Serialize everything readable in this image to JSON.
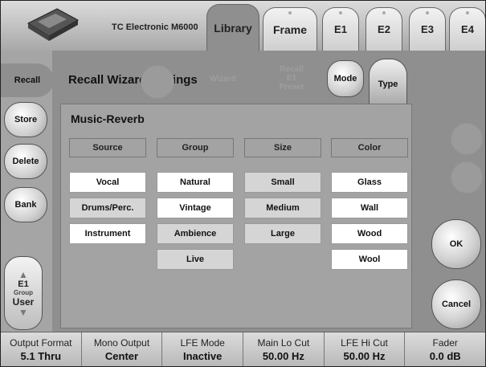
{
  "brand": "TC Electronic M6000",
  "tabs": [
    "Library",
    "Frame",
    "E1",
    "E2",
    "E3",
    "E4"
  ],
  "active_tab": "Library",
  "left_buttons": [
    "Recall",
    "Store",
    "Delete",
    "Bank"
  ],
  "group_button": {
    "line1": "E1",
    "line2": "Group",
    "line3": "User"
  },
  "header": {
    "title": "Recall Wizard Settings",
    "mode_label": "Mode",
    "type_label": "Type",
    "ghost_wizard": "Wizard",
    "ghost_recall": "Recall\nE1\nPreset"
  },
  "panel": {
    "title": "Music-Reverb",
    "columns": [
      {
        "header": "Source",
        "options": [
          "Vocal",
          "Drums/Perc.",
          "Instrument"
        ]
      },
      {
        "header": "Group",
        "options": [
          "Natural",
          "Vintage",
          "Ambience",
          "Live"
        ]
      },
      {
        "header": "Size",
        "options": [
          "Small",
          "Medium",
          "Large"
        ]
      },
      {
        "header": "Color",
        "options": [
          "Glass",
          "Wall",
          "Wood",
          "Wool"
        ]
      }
    ]
  },
  "ok_label": "OK",
  "cancel_label": "Cancel",
  "status": [
    {
      "label": "Output Format",
      "value": "5.1 Thru"
    },
    {
      "label": "Mono Output",
      "value": "Center"
    },
    {
      "label": "LFE Mode",
      "value": "Inactive"
    },
    {
      "label": "Main Lo Cut",
      "value": "50.00 Hz"
    },
    {
      "label": "LFE Hi Cut",
      "value": "50.00 Hz"
    },
    {
      "label": "Fader",
      "value": "0.0 dB"
    }
  ]
}
